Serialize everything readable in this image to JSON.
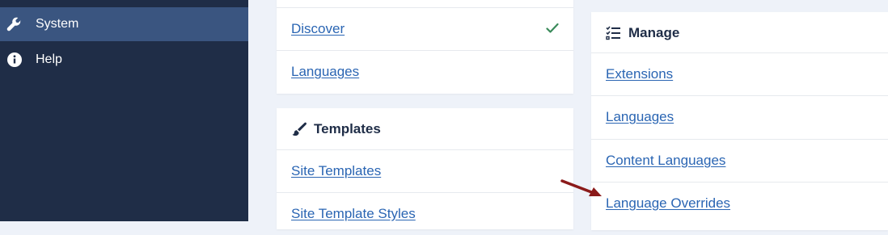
{
  "sidebar": {
    "items": [
      {
        "label": "System",
        "icon": "wrench-icon",
        "active": true
      },
      {
        "label": "Help",
        "icon": "info-icon",
        "active": false
      }
    ]
  },
  "install_card": {
    "items": [
      {
        "label": "Discover",
        "status_icon": "checkmark-icon"
      },
      {
        "label": "Languages"
      }
    ]
  },
  "templates_card": {
    "title": "Templates",
    "icon": "paintbrush-icon",
    "items": [
      {
        "label": "Site Templates"
      },
      {
        "label": "Site Template Styles"
      }
    ]
  },
  "manage_card": {
    "title": "Manage",
    "icon": "checklist-icon",
    "items": [
      {
        "label": "Extensions"
      },
      {
        "label": "Languages"
      },
      {
        "label": "Content Languages"
      },
      {
        "label": "Language Overrides"
      }
    ]
  },
  "annotation": {
    "icon": "red-arrow-icon",
    "color": "#8b1a1a"
  },
  "colors": {
    "sidebar": "#1f2d47",
    "sidebar_active": "#3a5580",
    "link": "#2a65b3",
    "check": "#3a8a5a"
  }
}
